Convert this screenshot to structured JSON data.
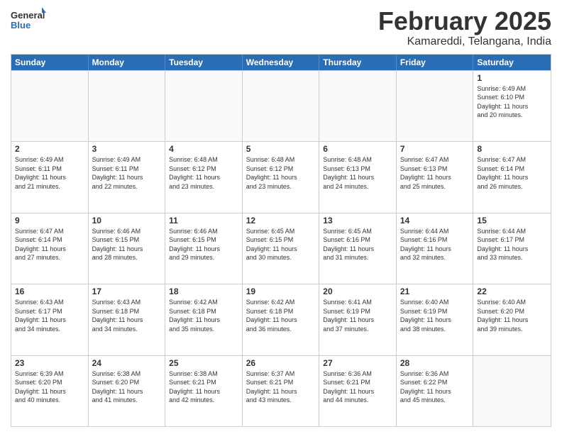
{
  "logo": {
    "general": "General",
    "blue": "Blue"
  },
  "title": "February 2025",
  "subtitle": "Kamareddi, Telangana, India",
  "days": [
    "Sunday",
    "Monday",
    "Tuesday",
    "Wednesday",
    "Thursday",
    "Friday",
    "Saturday"
  ],
  "rows": [
    [
      {
        "day": "",
        "text": ""
      },
      {
        "day": "",
        "text": ""
      },
      {
        "day": "",
        "text": ""
      },
      {
        "day": "",
        "text": ""
      },
      {
        "day": "",
        "text": ""
      },
      {
        "day": "",
        "text": ""
      },
      {
        "day": "1",
        "text": "Sunrise: 6:49 AM\nSunset: 6:10 PM\nDaylight: 11 hours\nand 20 minutes."
      }
    ],
    [
      {
        "day": "2",
        "text": "Sunrise: 6:49 AM\nSunset: 6:11 PM\nDaylight: 11 hours\nand 21 minutes."
      },
      {
        "day": "3",
        "text": "Sunrise: 6:49 AM\nSunset: 6:11 PM\nDaylight: 11 hours\nand 22 minutes."
      },
      {
        "day": "4",
        "text": "Sunrise: 6:48 AM\nSunset: 6:12 PM\nDaylight: 11 hours\nand 23 minutes."
      },
      {
        "day": "5",
        "text": "Sunrise: 6:48 AM\nSunset: 6:12 PM\nDaylight: 11 hours\nand 23 minutes."
      },
      {
        "day": "6",
        "text": "Sunrise: 6:48 AM\nSunset: 6:13 PM\nDaylight: 11 hours\nand 24 minutes."
      },
      {
        "day": "7",
        "text": "Sunrise: 6:47 AM\nSunset: 6:13 PM\nDaylight: 11 hours\nand 25 minutes."
      },
      {
        "day": "8",
        "text": "Sunrise: 6:47 AM\nSunset: 6:14 PM\nDaylight: 11 hours\nand 26 minutes."
      }
    ],
    [
      {
        "day": "9",
        "text": "Sunrise: 6:47 AM\nSunset: 6:14 PM\nDaylight: 11 hours\nand 27 minutes."
      },
      {
        "day": "10",
        "text": "Sunrise: 6:46 AM\nSunset: 6:15 PM\nDaylight: 11 hours\nand 28 minutes."
      },
      {
        "day": "11",
        "text": "Sunrise: 6:46 AM\nSunset: 6:15 PM\nDaylight: 11 hours\nand 29 minutes."
      },
      {
        "day": "12",
        "text": "Sunrise: 6:45 AM\nSunset: 6:15 PM\nDaylight: 11 hours\nand 30 minutes."
      },
      {
        "day": "13",
        "text": "Sunrise: 6:45 AM\nSunset: 6:16 PM\nDaylight: 11 hours\nand 31 minutes."
      },
      {
        "day": "14",
        "text": "Sunrise: 6:44 AM\nSunset: 6:16 PM\nDaylight: 11 hours\nand 32 minutes."
      },
      {
        "day": "15",
        "text": "Sunrise: 6:44 AM\nSunset: 6:17 PM\nDaylight: 11 hours\nand 33 minutes."
      }
    ],
    [
      {
        "day": "16",
        "text": "Sunrise: 6:43 AM\nSunset: 6:17 PM\nDaylight: 11 hours\nand 34 minutes."
      },
      {
        "day": "17",
        "text": "Sunrise: 6:43 AM\nSunset: 6:18 PM\nDaylight: 11 hours\nand 34 minutes."
      },
      {
        "day": "18",
        "text": "Sunrise: 6:42 AM\nSunset: 6:18 PM\nDaylight: 11 hours\nand 35 minutes."
      },
      {
        "day": "19",
        "text": "Sunrise: 6:42 AM\nSunset: 6:18 PM\nDaylight: 11 hours\nand 36 minutes."
      },
      {
        "day": "20",
        "text": "Sunrise: 6:41 AM\nSunset: 6:19 PM\nDaylight: 11 hours\nand 37 minutes."
      },
      {
        "day": "21",
        "text": "Sunrise: 6:40 AM\nSunset: 6:19 PM\nDaylight: 11 hours\nand 38 minutes."
      },
      {
        "day": "22",
        "text": "Sunrise: 6:40 AM\nSunset: 6:20 PM\nDaylight: 11 hours\nand 39 minutes."
      }
    ],
    [
      {
        "day": "23",
        "text": "Sunrise: 6:39 AM\nSunset: 6:20 PM\nDaylight: 11 hours\nand 40 minutes."
      },
      {
        "day": "24",
        "text": "Sunrise: 6:38 AM\nSunset: 6:20 PM\nDaylight: 11 hours\nand 41 minutes."
      },
      {
        "day": "25",
        "text": "Sunrise: 6:38 AM\nSunset: 6:21 PM\nDaylight: 11 hours\nand 42 minutes."
      },
      {
        "day": "26",
        "text": "Sunrise: 6:37 AM\nSunset: 6:21 PM\nDaylight: 11 hours\nand 43 minutes."
      },
      {
        "day": "27",
        "text": "Sunrise: 6:36 AM\nSunset: 6:21 PM\nDaylight: 11 hours\nand 44 minutes."
      },
      {
        "day": "28",
        "text": "Sunrise: 6:36 AM\nSunset: 6:22 PM\nDaylight: 11 hours\nand 45 minutes."
      },
      {
        "day": "",
        "text": ""
      }
    ]
  ]
}
